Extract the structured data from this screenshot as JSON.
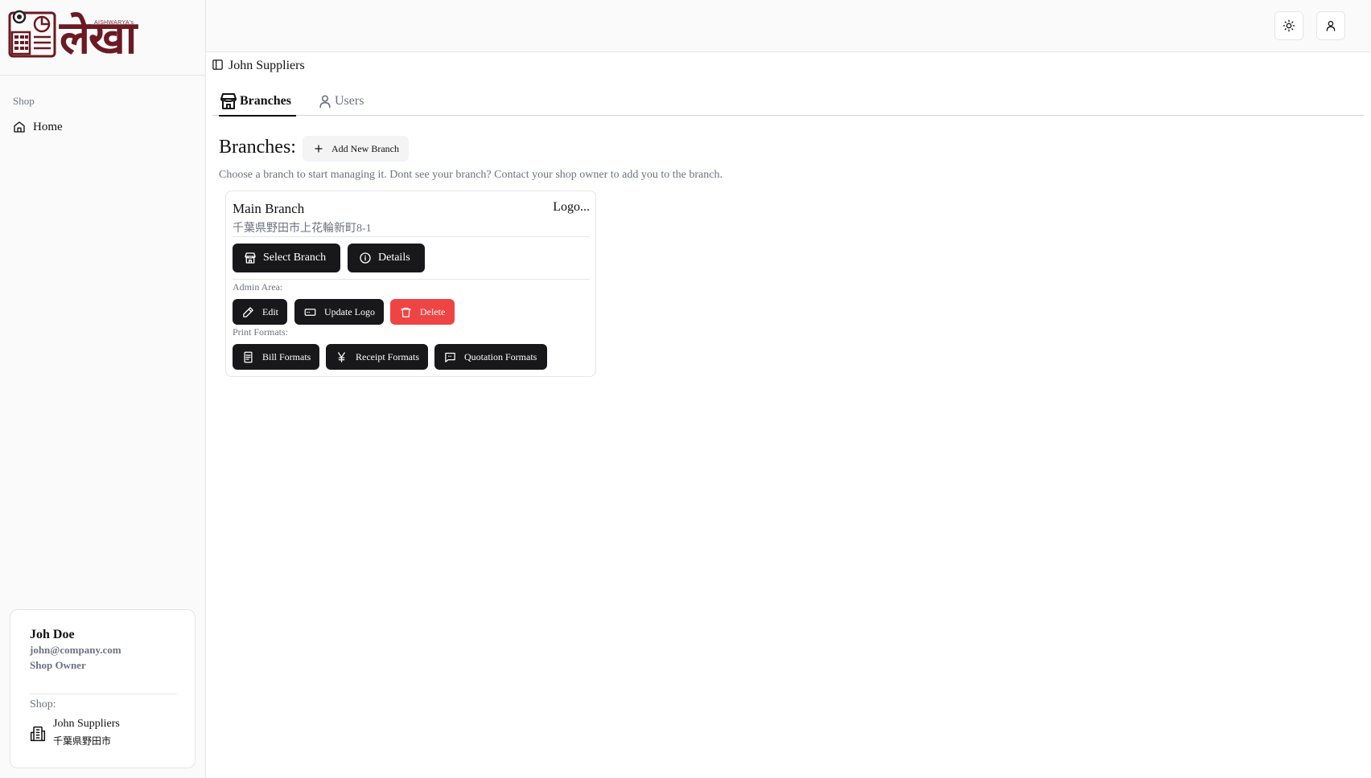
{
  "brand": {
    "tagline": "AISHWARYA's",
    "wordmark": "लेखा"
  },
  "sidebar": {
    "group_label": "Shop",
    "items": [
      {
        "label": "Home",
        "icon": "home-icon"
      }
    ]
  },
  "user": {
    "name": "Joh Doe",
    "email": "john@company.com",
    "role": "Shop Owner",
    "shop_label": "Shop:",
    "shop_name": "John Suppliers",
    "shop_address": "千葉県野田市"
  },
  "topbar": {
    "theme_icon": "sun-icon",
    "account_icon": "user-icon"
  },
  "breadcrumb": {
    "icon": "sidebar-toggle-icon",
    "title": "John Suppliers"
  },
  "tabs": [
    {
      "label": "Branches",
      "icon": "store-icon",
      "active": true
    },
    {
      "label": "Users",
      "icon": "user-icon",
      "active": false
    }
  ],
  "main": {
    "heading": "Branches:",
    "add_button": "Add New Branch",
    "hint": "Choose a branch to start managing it. Dont see your branch? Contact your shop owner to add you to the branch."
  },
  "branch": {
    "name": "Main Branch",
    "logo_text": "Logo...",
    "address": "千葉県野田市上花輪新町8-1",
    "select_button": "Select Branch",
    "details_button": "Details",
    "admin_label": "Admin Area:",
    "edit_button": "Edit",
    "update_logo_button": "Update Logo",
    "delete_button": "Delete",
    "print_label": "Print Formats:",
    "bill_button": "Bill Formats",
    "receipt_button": "Receipt Formats",
    "quotation_button": "Quotation Formats"
  },
  "colors": {
    "accent_dark": "#18181b",
    "danger": "#ef4444",
    "brand": "#6b1a23"
  }
}
